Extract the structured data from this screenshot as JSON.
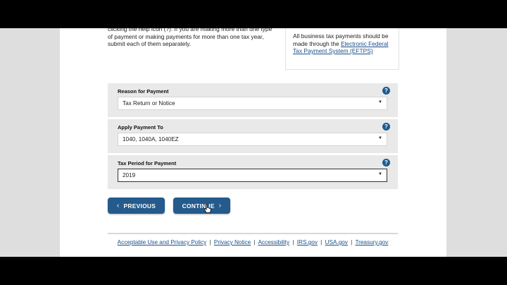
{
  "intro": {
    "text": "clicking the help icon (?). If you are making more than one type of payment or making payments for more than one tax year, submit each of them separately."
  },
  "infobox": {
    "text": "All business tax payments should be made through the",
    "link": "Electronic Federal Tax Payment System (EFTPS)"
  },
  "fields": [
    {
      "label": "Reason for Payment",
      "value": "Tax Return or Notice"
    },
    {
      "label": "Apply Payment To",
      "value": "1040, 1040A, 1040EZ"
    },
    {
      "label": "Tax Period for Payment",
      "value": "2019"
    }
  ],
  "help_glyph": "?",
  "buttons": {
    "previous": "PREVIOUS",
    "continue": "CONTINUE"
  },
  "footer": {
    "links": [
      "Acceptable Use and Privacy Policy",
      "Privacy Notice",
      "Accessibility",
      "IRS.gov",
      "USA.gov",
      "Treasury.gov"
    ],
    "separator": "|"
  },
  "colors": {
    "button": "#245a8c",
    "help_icon": "#1c5a8f",
    "link": "#1a4f8a",
    "field_bg": "#e9e9e9"
  }
}
